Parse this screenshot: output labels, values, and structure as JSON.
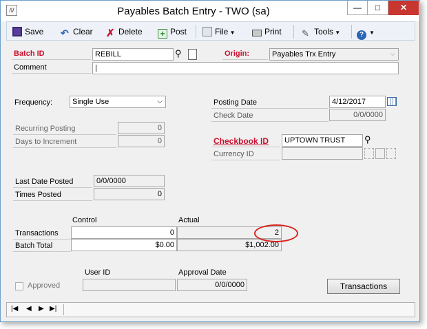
{
  "window": {
    "title": "Payables Batch Entry  -  TWO (sa)"
  },
  "toolbar": {
    "save": "Save",
    "clear": "Clear",
    "delete": "Delete",
    "post": "Post",
    "file": "File",
    "print": "Print",
    "tools": "Tools"
  },
  "form": {
    "batch_id_label": "Batch ID",
    "batch_id_value": "REBILL",
    "origin_label": "Origin:",
    "origin_value": "Payables Trx Entry",
    "comment_label": "Comment",
    "comment_value": "|",
    "frequency_label": "Frequency:",
    "frequency_value": "Single Use",
    "posting_date_label": "Posting Date",
    "posting_date_value": "4/12/2017",
    "check_date_label": "Check Date",
    "check_date_value": "0/0/0000",
    "recurring_posting_label": "Recurring Posting",
    "recurring_posting_value": "0",
    "days_to_increment_label": "Days to Increment",
    "days_to_increment_value": "0",
    "checkbook_id_label": "Checkbook ID",
    "checkbook_id_value": "UPTOWN TRUST",
    "currency_id_label": "Currency ID",
    "currency_id_value": "",
    "last_date_posted_label": "Last Date Posted",
    "last_date_posted_value": "0/0/0000",
    "times_posted_label": "Times Posted",
    "times_posted_value": "0",
    "control_header": "Control",
    "actual_header": "Actual",
    "transactions_label": "Transactions",
    "transactions_control": "0",
    "transactions_actual": "2",
    "batch_total_label": "Batch Total",
    "batch_total_control": "$0.00",
    "batch_total_actual": "$1,002.00",
    "approved_label": "Approved",
    "user_id_header": "User ID",
    "user_id_value": "",
    "approval_date_header": "Approval Date",
    "approval_date_value": "0/0/0000",
    "transactions_button": "Transactions"
  }
}
